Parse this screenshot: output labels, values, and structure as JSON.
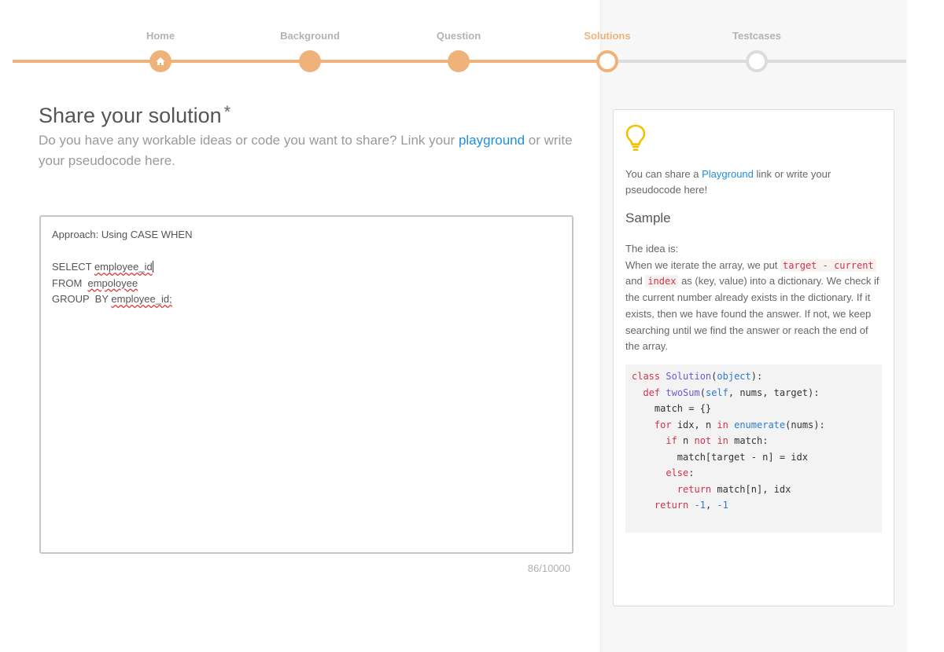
{
  "stepper": {
    "steps": [
      {
        "label": "Home",
        "state": "done"
      },
      {
        "label": "Background",
        "state": "done"
      },
      {
        "label": "Question",
        "state": "done"
      },
      {
        "label": "Solutions",
        "state": "current"
      },
      {
        "label": "Testcases",
        "state": "todo"
      }
    ],
    "colors": {
      "done": "#efb27a",
      "todo": "#dcdcdc"
    }
  },
  "main": {
    "title": "Share your solution",
    "required_mark": "*",
    "subtitle_before": "Do you have any workable ideas or code you want to share? Link your",
    "subtitle_link": "playground",
    "subtitle_after": "or write your pseudocode here.",
    "editor": {
      "line1": "Approach: Using CASE WHEN",
      "line3_a": "SELECT ",
      "line3_b": "employee_id",
      "line4_a": "FROM  ",
      "line4_b": "empoloyee",
      "line5_a": "GROUP  BY ",
      "line5_b": "employee_id;"
    },
    "counter": "86/10000"
  },
  "tip": {
    "icon": "lightbulb-icon",
    "text_before": "You can share a",
    "text_link": "Playground",
    "text_after": "link or write your pseudocode here!",
    "sample_title": "Sample",
    "idea_line1": "The idea is:",
    "idea_p1": "When we iterate the array, we put",
    "idea_code1": "target - current",
    "idea_p2": "and",
    "idea_code2": "index",
    "idea_p3": "as (key, value) into a dictionary. We check if the current number already exists in the dictionary. If it exists, then we have found the answer. If not, we keep searching until we find the answer or reach the end of the array.",
    "code": {
      "l1_kw": "class",
      "l1_name": "Solution",
      "l1_base": "object",
      "l1_end": "):",
      "l2_kw": "def",
      "l2_name": "twoSum",
      "l2_self": "self",
      "l2_rest": ", nums, target):",
      "l3": "match = {}",
      "l4_kw": "for",
      "l4_a": "idx, n",
      "l4_in": "in",
      "l4_bi": "enumerate",
      "l4_rest": "(nums):",
      "l5_kw": "if",
      "l5_a": "n",
      "l5_not": "not",
      "l5_in": "in",
      "l5_rest": "match:",
      "l6": "match[target - n] = idx",
      "l7_kw": "else",
      "l8_kw": "return",
      "l8_rest": "match[n], idx",
      "l9_kw": "return",
      "l9_n1": "-1",
      "l9_n2": "-1"
    }
  }
}
